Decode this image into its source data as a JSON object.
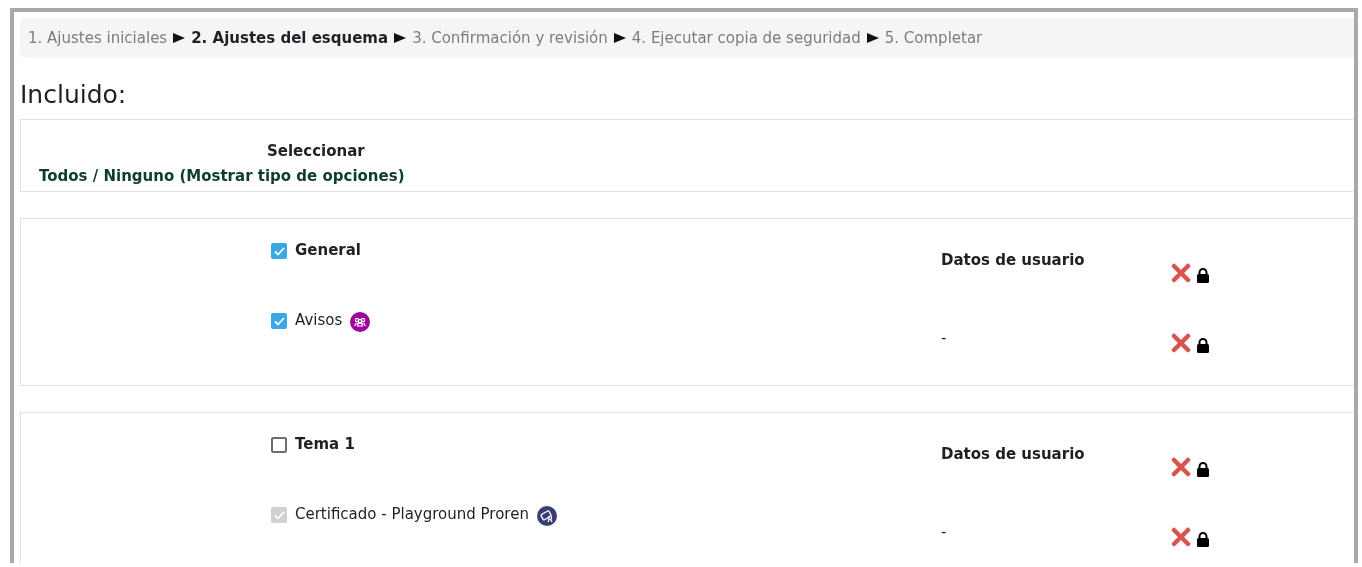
{
  "steps": [
    {
      "label": "1. Ajustes iniciales",
      "selected": false
    },
    {
      "label": "2. Ajustes del esquema",
      "selected": true
    },
    {
      "label": "3. Confirmación y revisión",
      "selected": false
    },
    {
      "label": "4. Ejecutar copia de seguridad",
      "selected": false
    },
    {
      "label": "5. Completar",
      "selected": false
    }
  ],
  "heading": "Incluido:",
  "select_box": {
    "title": "Seleccionar",
    "links": "Todos / Ninguno (Mostrar tipo de opciones)"
  },
  "sections": [
    {
      "items": [
        {
          "label": "General",
          "checked": true,
          "disabled": false,
          "bold": true,
          "user_data": "Datos de usuario",
          "user_data_included": false
        },
        {
          "label": "Avisos",
          "checked": true,
          "disabled": false,
          "bold": false,
          "kind": "forum",
          "user_data": "-",
          "user_data_included": false
        }
      ]
    },
    {
      "items": [
        {
          "label": "Tema 1",
          "checked": false,
          "disabled": false,
          "bold": true,
          "user_data": "Datos de usuario",
          "user_data_included": false
        },
        {
          "label": "Certificado - Playground Proren",
          "checked": true,
          "disabled": true,
          "bold": false,
          "kind": "certificate",
          "user_data": "-",
          "user_data_included": false
        }
      ]
    }
  ]
}
